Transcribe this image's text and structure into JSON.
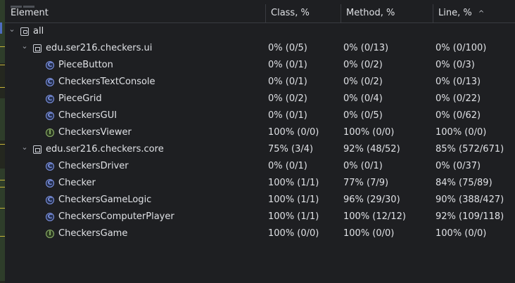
{
  "header": {
    "element": "Element",
    "class": "Class, %",
    "method": "Method, %",
    "line": "Line, %",
    "sort_icon": "chevron-up-icon"
  },
  "rows": [
    {
      "name": "all",
      "type": "root",
      "class": "",
      "method": "",
      "line": ""
    },
    {
      "name": "edu.ser216.checkers.ui",
      "type": "package",
      "class": "0% (0/5)",
      "method": "0% (0/13)",
      "line": "0% (0/100)"
    },
    {
      "name": "PieceButton",
      "type": "class",
      "class": "0% (0/1)",
      "method": "0% (0/2)",
      "line": "0% (0/3)"
    },
    {
      "name": "CheckersTextConsole",
      "type": "class",
      "class": "0% (0/1)",
      "method": "0% (0/2)",
      "line": "0% (0/13)"
    },
    {
      "name": "PieceGrid",
      "type": "class",
      "class": "0% (0/2)",
      "method": "0% (0/4)",
      "line": "0% (0/22)"
    },
    {
      "name": "CheckersGUI",
      "type": "class",
      "class": "0% (0/1)",
      "method": "0% (0/5)",
      "line": "0% (0/62)"
    },
    {
      "name": "CheckersViewer",
      "type": "interface",
      "class": "100% (0/0)",
      "method": "100% (0/0)",
      "line": "100% (0/0)"
    },
    {
      "name": "edu.ser216.checkers.core",
      "type": "package",
      "class": "75% (3/4)",
      "method": "92% (48/52)",
      "line": "85% (572/671)"
    },
    {
      "name": "CheckersDriver",
      "type": "class",
      "class": "0% (0/1)",
      "method": "0% (0/1)",
      "line": "0% (0/37)"
    },
    {
      "name": "Checker",
      "type": "class",
      "class": "100% (1/1)",
      "method": "77% (7/9)",
      "line": "84% (75/89)"
    },
    {
      "name": "CheckersGameLogic",
      "type": "class",
      "class": "100% (1/1)",
      "method": "96% (29/30)",
      "line": "90% (388/427)"
    },
    {
      "name": "CheckersComputerPlayer",
      "type": "class",
      "class": "100% (1/1)",
      "method": "100% (12/12)",
      "line": "92% (109/118)"
    },
    {
      "name": "CheckersGame",
      "type": "interface",
      "class": "100% (0/0)",
      "method": "100% (0/0)",
      "line": "100% (0/0)"
    }
  ],
  "icon_glyphs": {
    "class": "C",
    "interface": "I"
  },
  "colors": {
    "class_icon": "#7f95e6",
    "interface_icon": "#8fb56a",
    "background": "#1e1f22"
  }
}
